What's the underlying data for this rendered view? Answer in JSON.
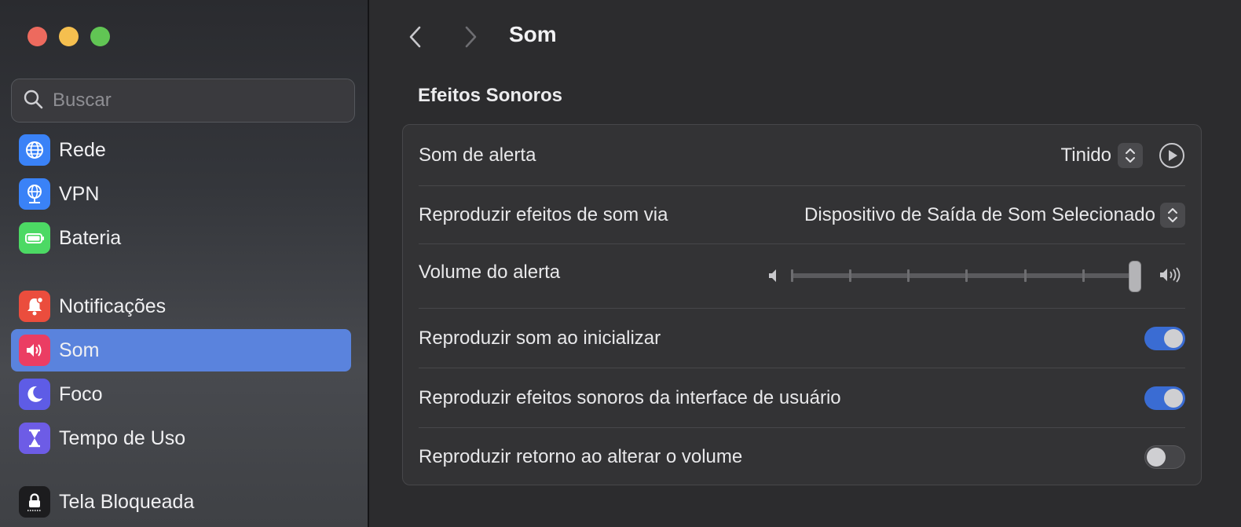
{
  "window": {
    "title": "Som"
  },
  "sidebar": {
    "search_placeholder": "Buscar",
    "items": [
      {
        "label": "Rede",
        "icon": "globe-icon",
        "color": "#3a82f7"
      },
      {
        "label": "VPN",
        "icon": "vpn-globe-icon",
        "color": "#3a82f7"
      },
      {
        "label": "Bateria",
        "icon": "battery-icon",
        "color": "#4cd964"
      },
      {
        "label": "Notificações",
        "icon": "bell-icon",
        "color": "#eb4d3d"
      },
      {
        "label": "Som",
        "icon": "speaker-icon",
        "color": "#eb3d63",
        "selected": true
      },
      {
        "label": "Foco",
        "icon": "moon-icon",
        "color": "#5e5ce6"
      },
      {
        "label": "Tempo de Uso",
        "icon": "hourglass-icon",
        "color": "#6d5ce6"
      },
      {
        "label": "Tela Bloqueada",
        "icon": "lock-icon",
        "color": "#1c1c1e"
      }
    ]
  },
  "main": {
    "title": "Som",
    "section_title": "Efeitos Sonoros",
    "rows": {
      "alert_sound": {
        "label": "Som de alerta",
        "value": "Tinido"
      },
      "play_via": {
        "label": "Reproduzir efeitos de som via",
        "value": "Dispositivo de Saída de Som Selecionado"
      },
      "alert_volume": {
        "label": "Volume do alerta",
        "level": 1.0
      },
      "startup_sound": {
        "label": "Reproduzir som ao inicializar",
        "on": true
      },
      "ui_sounds": {
        "label": "Reproduzir efeitos sonoros da interface de usuário",
        "on": true
      },
      "volume_feedback": {
        "label": "Reproduzir retorno ao alterar o volume",
        "on": false
      }
    }
  },
  "colors": {
    "accent": "#3a6cd3",
    "selection": "#5a83dd"
  }
}
